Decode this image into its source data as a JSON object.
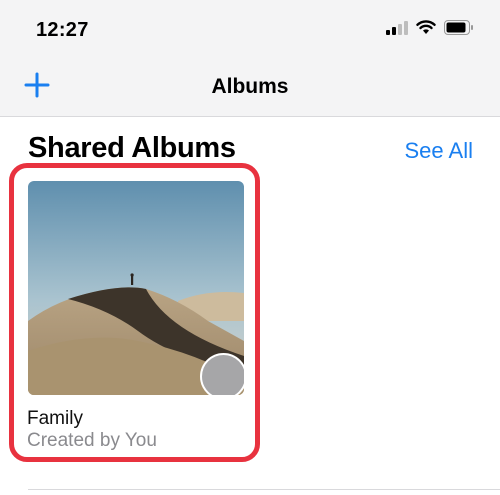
{
  "status_bar": {
    "time": "12:27",
    "icons": [
      "signal-icon",
      "wifi-icon",
      "battery-icon"
    ]
  },
  "nav": {
    "title": "Albums",
    "add_icon": "plus-icon",
    "accent_color": "#1a7ff0"
  },
  "section": {
    "title": "Shared Albums",
    "see_all_label": "See All"
  },
  "albums": [
    {
      "name": "Family",
      "subtitle": "Created by You",
      "thumbnail": "desert-dunes-photo",
      "avatar": "avatar-placeholder"
    }
  ],
  "colors": {
    "highlight_border": "#e8323f",
    "secondary_text": "#8a8a8e"
  }
}
